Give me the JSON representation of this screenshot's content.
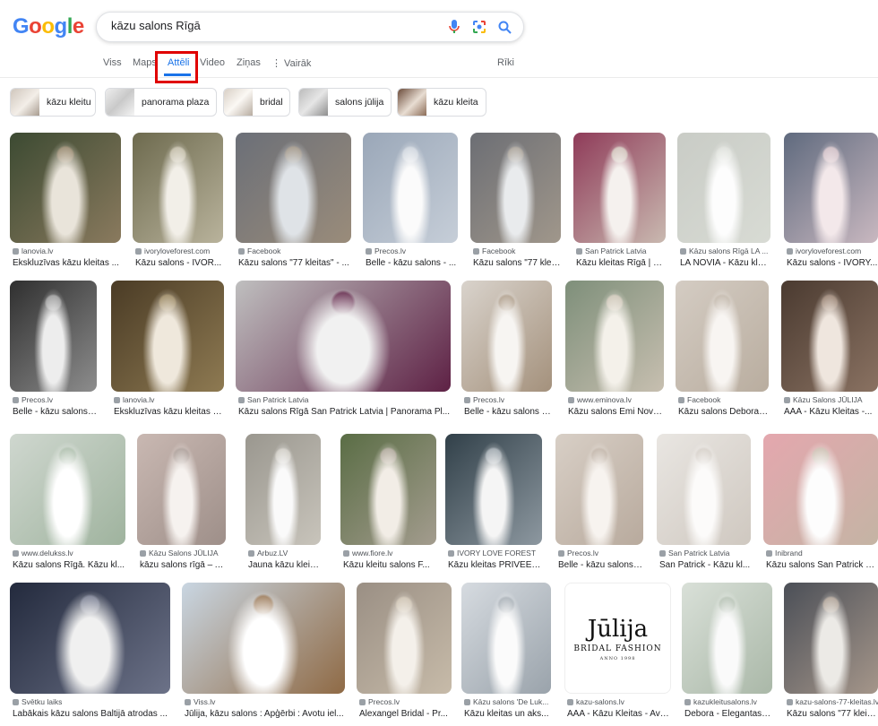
{
  "header": {
    "logo_text": "Google",
    "search_query": "kāzu salons Rīgā",
    "icons": [
      "microphone-icon",
      "lens-icon",
      "search-icon"
    ]
  },
  "tabs": [
    {
      "label": "Viss",
      "active": false
    },
    {
      "label": "Maps",
      "active": false
    },
    {
      "label": "Attēli",
      "active": true
    },
    {
      "label": "Video",
      "active": false
    },
    {
      "label": "Ziņas",
      "active": false
    },
    {
      "label": "⋮ Vairāk",
      "active": false
    },
    {
      "label": "Rīki",
      "active": false
    }
  ],
  "chips": [
    {
      "label": "kāzu kleitu"
    },
    {
      "label": "panorama plaza"
    },
    {
      "label": "bridal"
    },
    {
      "label": "salons jūlija"
    },
    {
      "label": "kāzu kleita"
    }
  ],
  "results": [
    {
      "source": "lanovia.lv",
      "title": "Ekskluzīvas kāzu kleitas ..."
    },
    {
      "source": "ivoryloveforest.com",
      "title": "Kāzu salons - IVOR..."
    },
    {
      "source": "Facebook",
      "title": "Kāzu salons \"77 kleitas\" - ..."
    },
    {
      "source": "Precos.lv",
      "title": "Belle - kāzu salons - ..."
    },
    {
      "source": "Facebook",
      "title": "Kāzu salons \"77 klei..."
    },
    {
      "source": "San Patrick Latvia",
      "title": "Kāzu kleitas Rīgā | K..."
    },
    {
      "source": "Kāzu salons Rīgā LA ...",
      "title": "LA NOVIA - Kāzu klei..."
    },
    {
      "source": "ivoryloveforest.com",
      "title": "Kāzu salons - IVORY..."
    },
    {
      "source": "Precos.lv",
      "title": "Belle - kāzu salons -..."
    },
    {
      "source": "lanovia.lv",
      "title": "Ekskluzīvas kāzu kleitas n..."
    },
    {
      "source": "San Patrick Latvia",
      "title": "Kāzu salons Rīgā San Patrick Latvia | Panorama Pl..."
    },
    {
      "source": "Precos.lv",
      "title": "Belle - kāzu salons -..."
    },
    {
      "source": "www.eminova.lv",
      "title": "Kāzu salons Emi Nova..."
    },
    {
      "source": "Facebook",
      "title": "Kāzu salons Debora ..."
    },
    {
      "source": "Kāzu Salons JŪLIJA",
      "title": "AAA - Kāzu Kleitas -..."
    },
    {
      "source": "www.delukss.lv",
      "title": "Kāzu salons Rīgā. Kāzu kl..."
    },
    {
      "source": "Kāzu Salons JŪLIJA",
      "title": "kāzu salons rīgā – A..."
    },
    {
      "source": "Arbuz.LV",
      "title": "Jauna kāzu kleita. T..."
    },
    {
      "source": "www.fiore.lv",
      "title": "Kāzu kleitu salons F..."
    },
    {
      "source": "IVORY LOVE FOREST",
      "title": "Kāzu kleitas PRIVEE R..."
    },
    {
      "source": "Precos.lv",
      "title": "Belle - kāzu salons -..."
    },
    {
      "source": "San Patrick Latvia",
      "title": "San Patrick - Kāzu kl..."
    },
    {
      "source": "Inibrand",
      "title": "Kāzu salons San Patrick Latv"
    },
    {
      "source": "Svētku laiks",
      "title": "Labākais kāzu salons Baltijā atrodas ..."
    },
    {
      "source": "Viss.lv",
      "title": "Jūlija, kāzu salons : Apģērbi : Avotu iel..."
    },
    {
      "source": "Precos.lv",
      "title": "Alexangel Bridal - Pr..."
    },
    {
      "source": "Kāzu salons 'De Luk...",
      "title": "Kāzu kleitas un aks..."
    },
    {
      "source": "kazu-salons.lv",
      "title": "AAA - Kāzu Kleitas - Avo..."
    },
    {
      "source": "kazukleitusalons.lv",
      "title": "Debora - Elegantas, ..."
    },
    {
      "source": "kazu-salons-77-kleitas.lv",
      "title": "Kāzu salons \"77 kleitas\""
    }
  ],
  "logo_tile": {
    "name": "Jūlija",
    "line1": "BRIDAL FASHION",
    "line2": "ANNO 1998"
  },
  "colors": {
    "accent": "#1a73e8",
    "highlight_box": "#e00000"
  }
}
